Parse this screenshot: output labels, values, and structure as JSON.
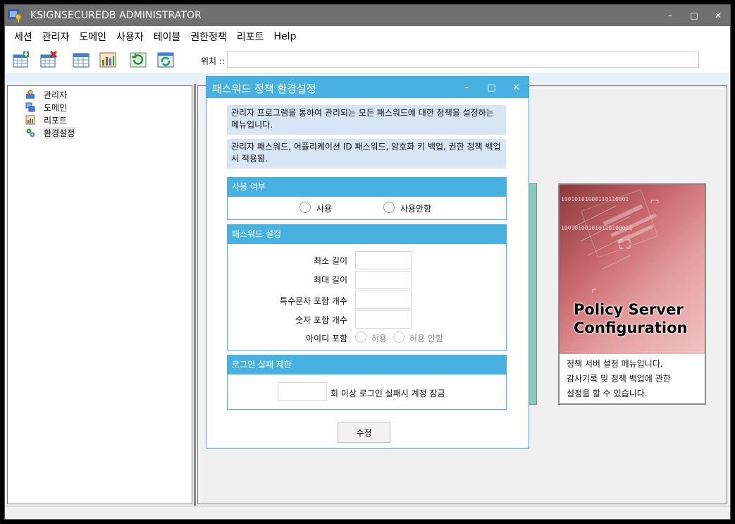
{
  "app": {
    "title": "KSIGNSECUREDB ADMINISTRATOR"
  },
  "window_buttons": {
    "minimize": "–",
    "maximize": "□",
    "close": "✕"
  },
  "menu": [
    "세션",
    "관리자",
    "도메인",
    "사용자",
    "테이블",
    "권한정책",
    "리포트",
    "Help"
  ],
  "toolbar": {
    "icons": [
      "add-table-icon",
      "delete-table-icon",
      "table-icon",
      "chart-icon",
      "refresh-back-icon",
      "refresh-icon"
    ],
    "location_label": "위치 ::",
    "location_value": ""
  },
  "tree": {
    "items": [
      {
        "label": "관리자",
        "icon": "admin-icon"
      },
      {
        "label": "도메인",
        "icon": "domain-icon"
      },
      {
        "label": "리포트",
        "icon": "report-icon"
      },
      {
        "label": "환경설정",
        "icon": "settings-icon",
        "selected": true
      }
    ]
  },
  "card": {
    "binary_text": "10010101000110110001\n100101001010110100011",
    "title_line1": "Policy Server",
    "title_line2": "Configuration",
    "desc_line1": "정책 서버 설정 메뉴입니다.",
    "desc_line2": "감사기록 및 정책 백업에 관한",
    "desc_line3": "설정을 할 수 있습니다."
  },
  "dialog": {
    "title": "패스워드 정책 환경설정",
    "info1": "관리자 프로그램을 통하여 관리되는 모든 패스워드에 대한 정책을 설정하는 메뉴입니다.",
    "info2": "관리자 패스워드, 어플리케이션 ID 패스워드, 암호화 키 백업, 권한 정책 백업 시 적용됨.",
    "usage": {
      "header": "사용 여부",
      "use_label": "사용",
      "not_use_label": "사용안함"
    },
    "password": {
      "header": "패스워드 설정",
      "min_length_label": "최소 길이",
      "max_length_label": "최대 길이",
      "special_count_label": "특수문자 포함 개수",
      "digit_count_label": "숫자 포함 개수",
      "id_include_label": "아이디 포함",
      "allow_label": "허용",
      "disallow_label": "허용 안함",
      "min_length_value": "",
      "max_length_value": "",
      "special_count_value": "",
      "digit_count_value": ""
    },
    "login": {
      "header": "로그인 실패 제한",
      "suffix_label": "회 이상 로그인 실패시 계정 잠금",
      "count_value": ""
    },
    "ok_label": "수정"
  },
  "colors": {
    "titlebar": "#707070",
    "accent": "#47b2e2",
    "info_bg": "#d8e5f4"
  }
}
